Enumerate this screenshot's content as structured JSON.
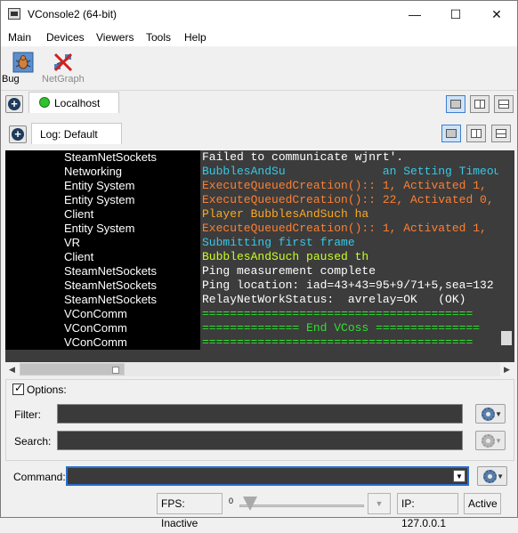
{
  "window": {
    "title": "VConsole2 (64-bit)",
    "minimize": "—",
    "maximize": "☐",
    "close": "✕"
  },
  "menu": [
    "Main",
    "Devices",
    "Viewers",
    "Tools",
    "Help"
  ],
  "toolbar": {
    "bug_label": "Bug",
    "netgraph_label": "NetGraph"
  },
  "device_tab": {
    "label": "Localhost"
  },
  "log_tab": {
    "label": "Log: Default"
  },
  "log": {
    "rows": [
      {
        "channel": "SteamNetSockets",
        "message": "Failed to communicate wjnrt'.",
        "color": "#ffffff"
      },
      {
        "channel": "Networking",
        "message": "BubblesAndSu              an Setting Timeout",
        "color": "#38c8e6"
      },
      {
        "channel": "Entity System",
        "message": "ExecuteQueuedCreation():: 1, Activated 1,",
        "color": "#ff7f32"
      },
      {
        "channel": "Entity System",
        "message": "ExecuteQueuedCreation():: 22, Activated 0,",
        "color": "#ff7f32"
      },
      {
        "channel": "Client",
        "message": "Player BubblesAndSuch ha",
        "color": "#ffa820"
      },
      {
        "channel": "Entity System",
        "message": "ExecuteQueuedCreation():: 1, Activated 1,",
        "color": "#ff7f32"
      },
      {
        "channel": "VR",
        "message": "Submitting first frame ",
        "color": "#38c8e6"
      },
      {
        "channel": "Client",
        "message": "BubblesAndSuch paused th",
        "color": "#c8ff20"
      },
      {
        "channel": "SteamNetSockets",
        "message": "Ping measurement complete",
        "color": "#ffffff"
      },
      {
        "channel": "SteamNetSockets",
        "message": "Ping location: iad=43+43=95+9/71+5,sea=132",
        "color": "#ffffff"
      },
      {
        "channel": "SteamNetSockets",
        "message": "RelayNetWorkStatus:  avrelay=OK   (OK)",
        "color": "#ffffff"
      },
      {
        "channel": "VConComm",
        "message": "=======================================",
        "color": "#2ee02e"
      },
      {
        "channel": "VConComm",
        "message": "============== End VCoss ===============",
        "color": "#2ee02e"
      },
      {
        "channel": "VConComm",
        "message": "=======================================",
        "color": "#2ee02e"
      }
    ]
  },
  "options": {
    "label": "Options:",
    "checked": true,
    "filter_label": "Filter:",
    "search_label": "Search:"
  },
  "command": {
    "label": "Command:"
  },
  "status": {
    "fps": "FPS: Inactive",
    "slider_min": "0",
    "ip": "IP: 127.0.0.1",
    "state": "Active"
  },
  "colors": {
    "log_background": "#000000",
    "accent": "#2a6fd0"
  }
}
